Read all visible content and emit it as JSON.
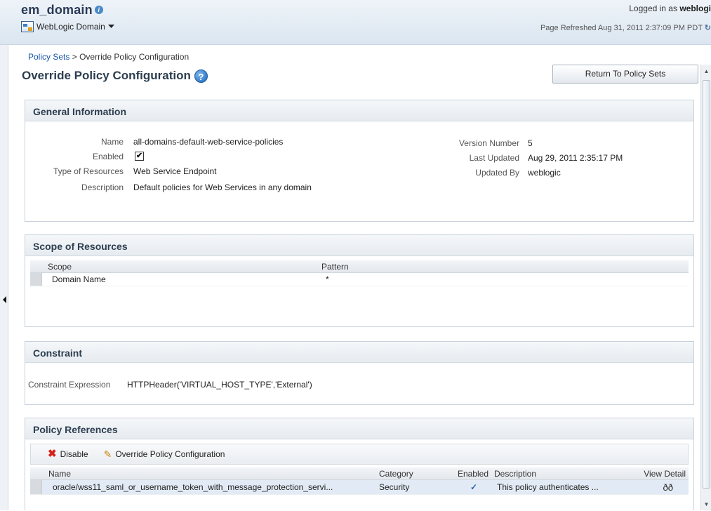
{
  "header": {
    "domain_title": "em_domain",
    "domain_info_glyph": "i",
    "menu_label": "WebLogic Domain",
    "login_prefix": "Logged in as",
    "login_user": "weblogi",
    "refresh_text": "Page Refreshed Aug 31, 2011 2:37:09 PM PDT",
    "refresh_glyph": "↻"
  },
  "breadcrumb": {
    "link": "Policy Sets",
    "separator": ">",
    "current": "Override Policy Configuration"
  },
  "page": {
    "title": "Override Policy Configuration",
    "help_glyph": "?",
    "return_button": "Return To Policy Sets"
  },
  "general_info": {
    "title": "General Information",
    "name_label": "Name",
    "name_value": "all-domains-default-web-service-policies",
    "enabled_label": "Enabled",
    "enabled_checked": true,
    "enabled_glyph": "✔",
    "type_label": "Type of Resources",
    "type_value": "Web Service Endpoint",
    "description_label": "Description",
    "description_value": "Default policies for Web Services in any domain",
    "version_label": "Version Number",
    "version_value": "5",
    "last_updated_label": "Last Updated",
    "last_updated_value": "Aug 29, 2011 2:35:17 PM",
    "updated_by_label": "Updated By",
    "updated_by_value": "weblogic"
  },
  "scope": {
    "title": "Scope of Resources",
    "columns": [
      "Scope",
      "Pattern"
    ],
    "rows": [
      {
        "scope": "Domain Name",
        "pattern": "*"
      }
    ]
  },
  "constraint": {
    "title": "Constraint",
    "label": "Constraint Expression",
    "value": "HTTPHeader('VIRTUAL_HOST_TYPE','External')"
  },
  "policy_refs": {
    "title": "Policy References",
    "disable_label": "Disable",
    "override_label": "Override Policy Configuration",
    "columns": [
      "Name",
      "Category",
      "Enabled",
      "Description",
      "View Detail"
    ],
    "rows": [
      {
        "name": "oracle/wss11_saml_or_username_token_with_message_protection_servi...",
        "category": "Security",
        "enabled_glyph": "✓",
        "description": "This policy authenticates ...",
        "view_glyph": "ðð"
      }
    ]
  },
  "icons": {
    "collapse": "left-arrow-icon",
    "scroll_up": "▲",
    "scroll_down": "▼"
  }
}
